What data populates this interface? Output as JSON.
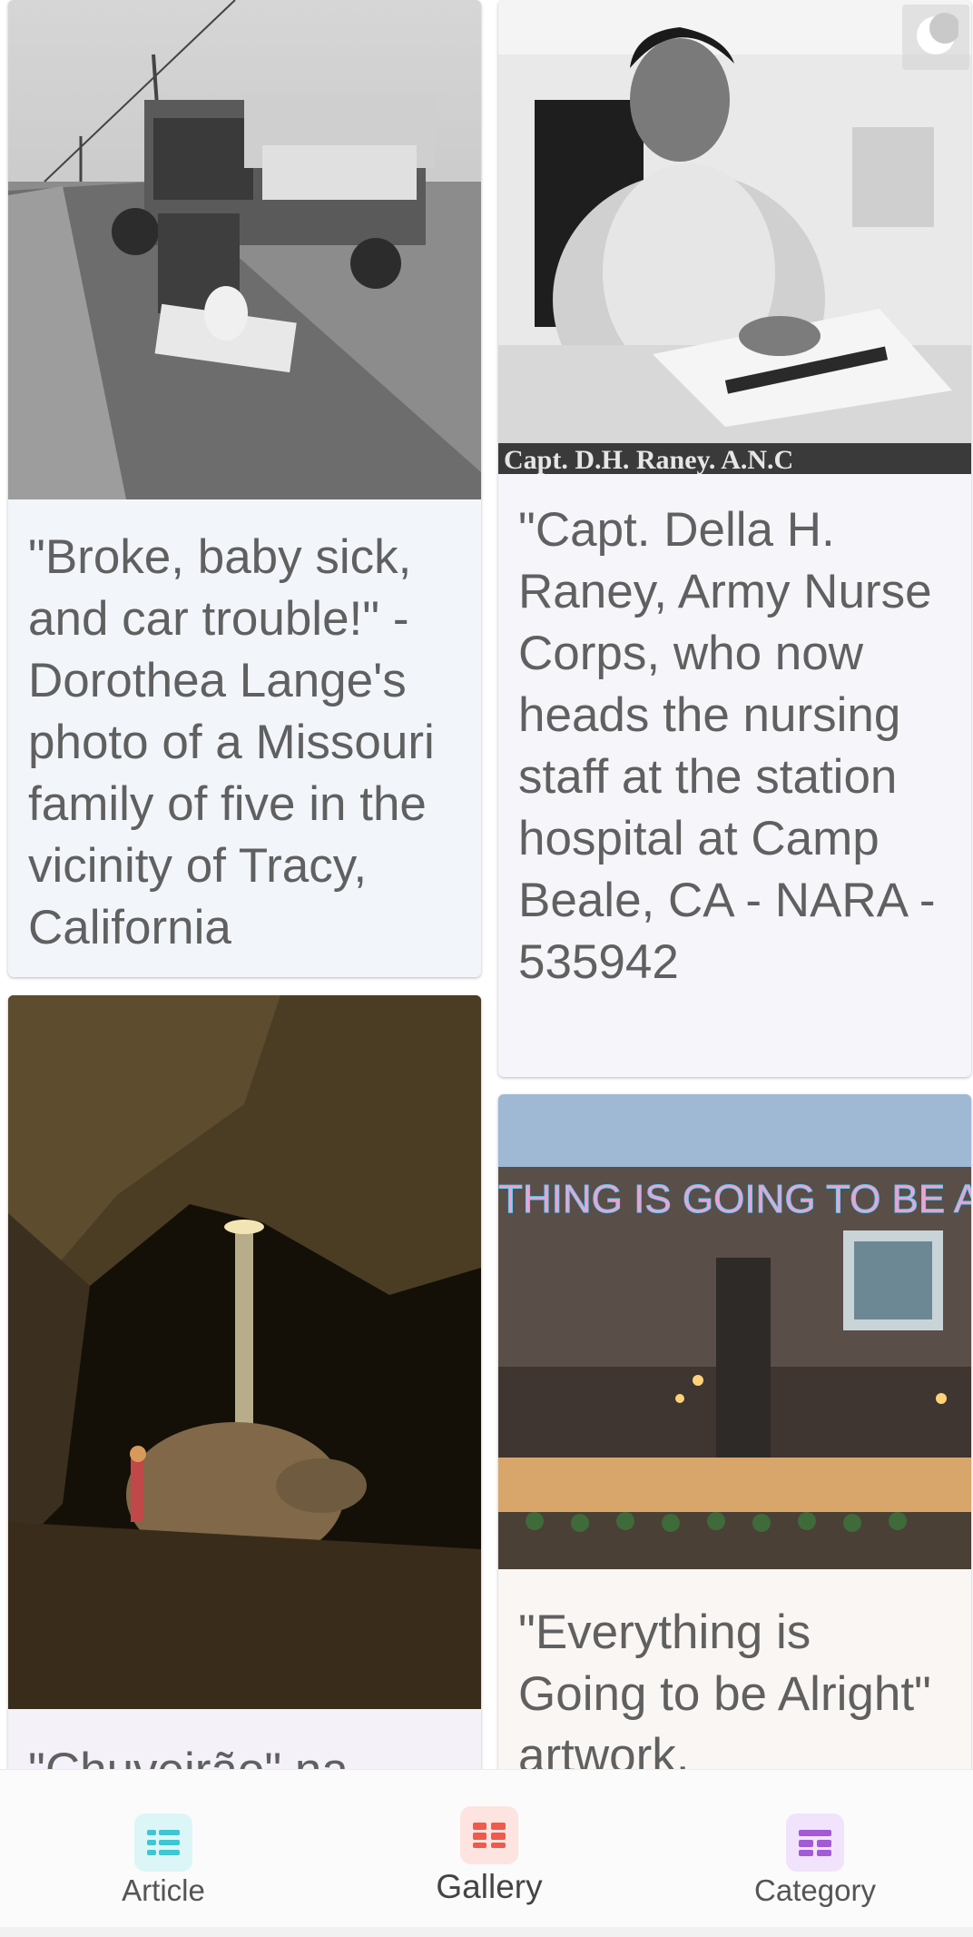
{
  "gallery": {
    "cards": [
      {
        "caption": "\"Broke, baby sick, and car trouble!\" - Dorothea Lange's photo of a Missouri family of five in the vicinity of Tracy, California",
        "image": "black-and-white photo: family car loaded with belongings by a dirt road"
      },
      {
        "caption": "\"Capt. Della H. Raney, Army Nurse Corps, who now heads the nursing staff at the station hospital at Camp Beale, CA - NARA - 535942",
        "image": "black-and-white portrait: woman at desk with documents",
        "photo_text": "Capt. D.H. Raney. A.N.C"
      },
      {
        "caption": "\"Chuveirão\" na",
        "image": "cave with a beam of light and a person standing near a rock"
      },
      {
        "caption": "\"Everything is Going to be Alright\" artwork,",
        "image": "building with colorful neon text at dusk",
        "photo_text": "THING IS GOING TO BE A"
      }
    ]
  },
  "theme_toggle": {
    "icon": "moon-icon"
  },
  "bottom_nav": {
    "items": [
      {
        "label": "Article",
        "icon": "article-list-icon",
        "color": "#3ec6d3",
        "bg": "#dcf5f7"
      },
      {
        "label": "Gallery",
        "icon": "gallery-grid-icon",
        "color": "#ef5a4c",
        "bg": "#fde4e1",
        "active": true
      },
      {
        "label": "Category",
        "icon": "category-icon",
        "color": "#a35ad6",
        "bg": "#f1e3fb"
      }
    ]
  }
}
